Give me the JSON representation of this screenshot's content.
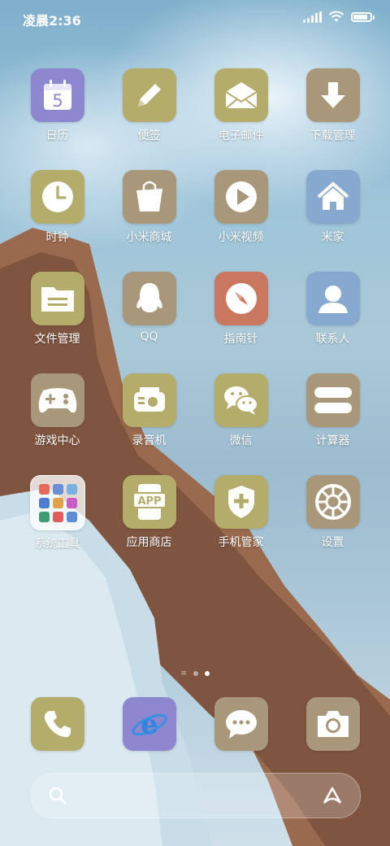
{
  "status_bar": {
    "time": "凌晨2:36"
  },
  "colors": {
    "olive": "#b4ac6a",
    "tan": "#a9977a",
    "purple": "#8d87cf",
    "blue": "#87a8cf",
    "red": "#c9785f"
  },
  "apps": [
    {
      "label": "日历",
      "icon": "calendar-icon",
      "color": "purple"
    },
    {
      "label": "便签",
      "icon": "pencil-icon",
      "color": "olive"
    },
    {
      "label": "电子邮件",
      "icon": "envelope-icon",
      "color": "olive"
    },
    {
      "label": "下载管理",
      "icon": "download-icon",
      "color": "tan"
    },
    {
      "label": "时钟",
      "icon": "clock-icon",
      "color": "olive"
    },
    {
      "label": "小米商城",
      "icon": "shopping-bag-icon",
      "color": "tan"
    },
    {
      "label": "小米视频",
      "icon": "play-icon",
      "color": "tan"
    },
    {
      "label": "米家",
      "icon": "home-icon",
      "color": "blue"
    },
    {
      "label": "文件管理",
      "icon": "folder-icon",
      "color": "olive"
    },
    {
      "label": "QQ",
      "icon": "penguin-icon",
      "color": "tan"
    },
    {
      "label": "指南针",
      "icon": "compass-icon",
      "color": "red"
    },
    {
      "label": "联系人",
      "icon": "person-icon",
      "color": "blue"
    },
    {
      "label": "游戏中心",
      "icon": "gamepad-icon",
      "color": "tan"
    },
    {
      "label": "录音机",
      "icon": "recorder-icon",
      "color": "olive"
    },
    {
      "label": "微信",
      "icon": "wechat-icon",
      "color": "olive"
    },
    {
      "label": "计算器",
      "icon": "calculator-icon",
      "color": "tan"
    },
    {
      "label": "系统工具",
      "icon": "folder-system-tools-icon",
      "color": "folder"
    },
    {
      "label": "应用商店",
      "icon": "app-store-icon",
      "color": "olive"
    },
    {
      "label": "手机管家",
      "icon": "shield-icon",
      "color": "olive"
    },
    {
      "label": "设置",
      "icon": "gear-icon",
      "color": "tan"
    }
  ],
  "calendar_day": "5",
  "app_store_text": "APP",
  "page_indicator": {
    "pages": 2,
    "current": 2
  },
  "dock": [
    {
      "icon": "phone-icon",
      "color": "olive"
    },
    {
      "icon": "browser-icon",
      "color": "purple"
    },
    {
      "icon": "messages-icon",
      "color": "tan"
    },
    {
      "icon": "camera-icon",
      "color": "tan"
    }
  ],
  "battery_level": 0.85
}
